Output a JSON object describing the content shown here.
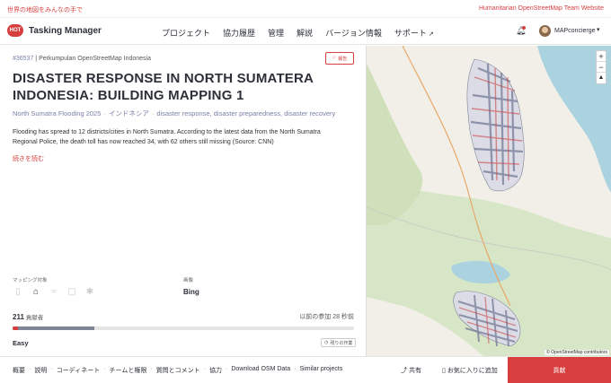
{
  "topbar": {
    "tagline": "世界の地図をみんなの手で",
    "hot_link": "Humanitarian OpenStreetMap Team Website"
  },
  "nav": {
    "logo_badge": "HOT",
    "app_name": "Tasking Manager",
    "menu": [
      "プロジェクト",
      "協力履歴",
      "管理",
      "解説",
      "バージョン情報",
      "サポート"
    ],
    "username": "MAPconcierge"
  },
  "project": {
    "id": "#36537",
    "org": " | Perkumpulan OpenStreetMap Indonesia",
    "flag_label": "報告",
    "title": "DISASTER RESPONSE IN NORTH SUMATERA INDONESIA: BUILDING MAPPING 1",
    "campaign": "North Sumatra Flooding 2025",
    "country": "インドネシア",
    "interests": "disaster response, disaster preparedness, disaster recovery",
    "description": "Flooding has spread to 12 districts/cities in North Sumatra. According to the latest data from the North Sumatra Regional Police, the death toll has now reached 34, with 62 others still missing (Source: CNN)",
    "read_more": "続きを読む"
  },
  "details": {
    "mapping_types_label": "マッピング対象",
    "imagery_label": "画像",
    "imagery_value": "Bing",
    "mapping_types": [
      {
        "icon": "road-icon",
        "active": false
      },
      {
        "icon": "building-icon",
        "active": true
      },
      {
        "icon": "waterway-icon",
        "active": false
      },
      {
        "icon": "landuse-icon",
        "active": false
      },
      {
        "icon": "other-icon",
        "active": false
      }
    ]
  },
  "stats": {
    "contributors_count": "211",
    "contributors_label": " 貢献者",
    "last_active": "以前の参加 28 秒前",
    "mapped_fraction": 0.24,
    "validated_fraction": 0.01,
    "difficulty": "Easy",
    "remaining_label": "残りの作業"
  },
  "map": {
    "attribution": "© OpenStreetMap contributors"
  },
  "footer": {
    "links": [
      "概要",
      "説明",
      "コーディネート",
      "チームと権限",
      "質問とコメント",
      "協力",
      "Download OSM Data",
      "Similar projects"
    ],
    "share": "共有",
    "favorite": "お気に入りに追加",
    "contribute": "貢献"
  },
  "colors": {
    "accent": "#d73f3f",
    "mapped": "#7d8597"
  }
}
